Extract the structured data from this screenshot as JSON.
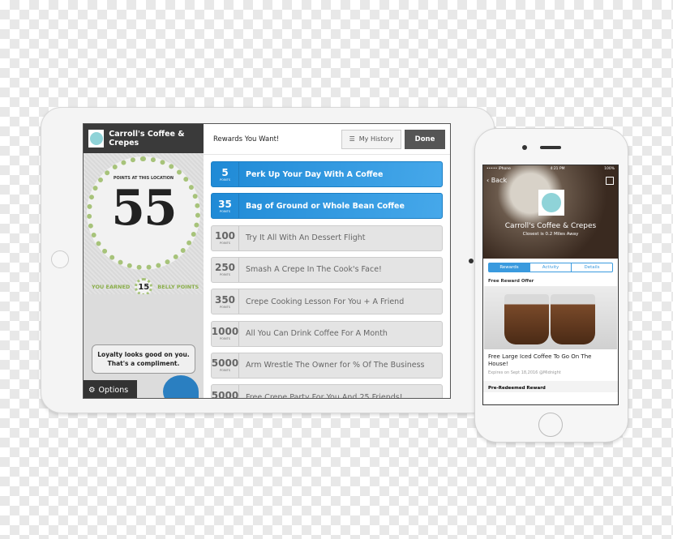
{
  "tablet": {
    "store_name": "Carroll's Coffee & Crepes",
    "points_label": "POINTS AT THIS LOCATION",
    "points": "55",
    "earned_prefix": "YOU EARNED",
    "earned_value": "15",
    "earned_suffix": "BELLY POINTS",
    "bubble_line1": "Loyalty looks good on you.",
    "bubble_line2": "That's a compliment.",
    "options_label": "Options",
    "header_title": "Rewards You Want!",
    "history_label": "My History",
    "done_label": "Done",
    "points_unit": "POINTS",
    "rewards": [
      {
        "points": "5",
        "name": "Perk Up Your Day With A Coffee",
        "available": true
      },
      {
        "points": "35",
        "name": "Bag of Ground or Whole Bean Coffee",
        "available": true
      },
      {
        "points": "100",
        "name": "Try It All With An Dessert Flight",
        "available": false
      },
      {
        "points": "250",
        "name": "Smash A Crepe In The Cook's Face!",
        "available": false
      },
      {
        "points": "350",
        "name": "Crepe Cooking Lesson For You + A Friend",
        "available": false
      },
      {
        "points": "1000",
        "name": "All You Can Drink Coffee For A Month",
        "available": false
      },
      {
        "points": "5000",
        "name": "Arm Wrestle The Owner for % Of The Business",
        "available": false
      },
      {
        "points": "5000",
        "name": "Free Crepe Party For You And 25 Friends!",
        "available": false
      }
    ],
    "accent": "#2b95dd"
  },
  "phone": {
    "carrier": "••••• iPhone",
    "time": "4:21 PM",
    "battery": "100%",
    "back_label": "Back",
    "store_name": "Carroll's Coffee & Crepes",
    "closest": "Closest is 0.2 Miles Away",
    "tabs": [
      "Rewards",
      "Activity",
      "Details"
    ],
    "section1": "Free Reward Offer",
    "offer_title": "Free Large Iced Coffee To Go On The House!",
    "offer_expiry": "Expires on Sept 18,2016 @Midnight",
    "section2": "Pre-Redeemed Reward"
  }
}
